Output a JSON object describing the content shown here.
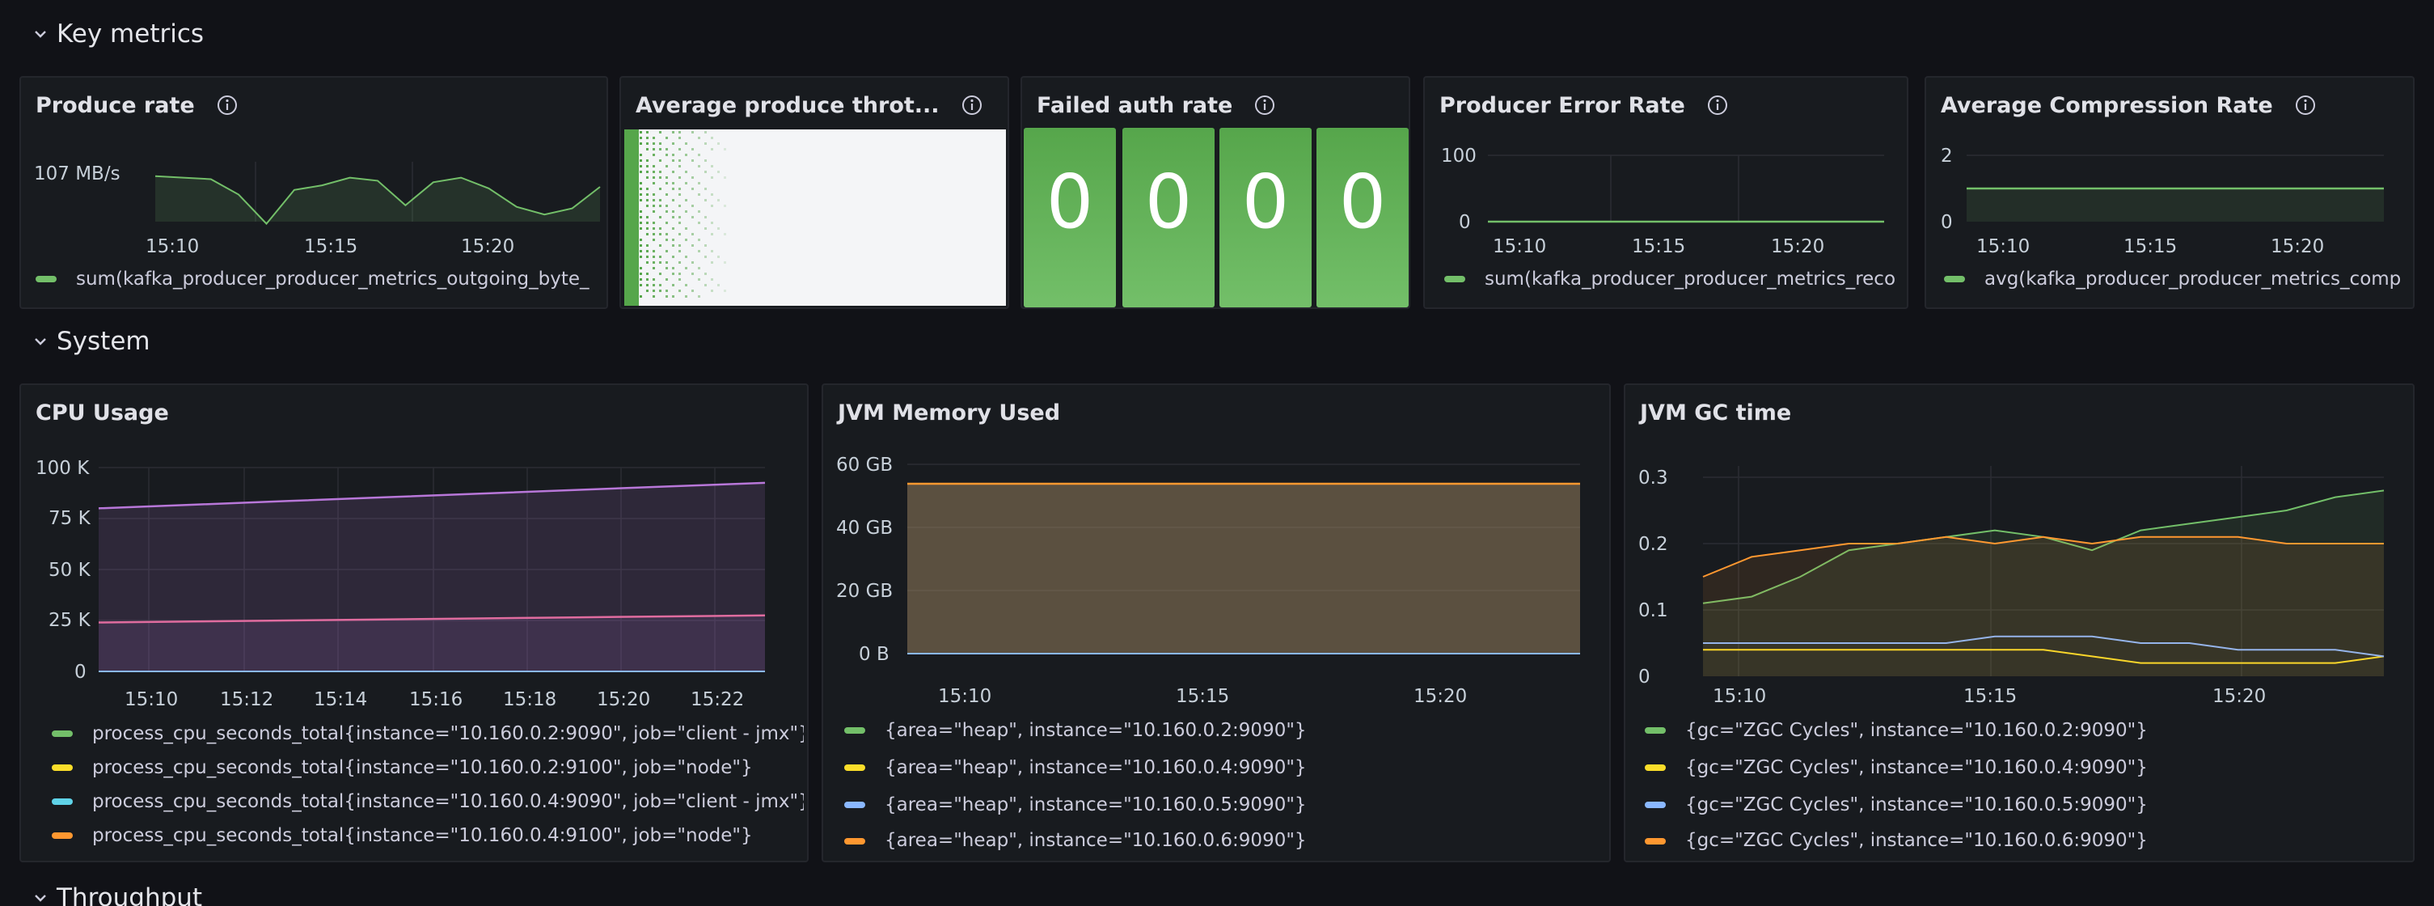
{
  "rows": {
    "key_metrics": "Key metrics",
    "system": "System",
    "throughput": "Throughput"
  },
  "panels": {
    "produce_rate": {
      "title": "Produce rate",
      "y_tick": "107 MB/s",
      "x_ticks": [
        "15:10",
        "15:15",
        "15:20"
      ],
      "legend": "sum(kafka_producer_producer_metrics_outgoing_byte_"
    },
    "avg_throttle": {
      "title": "Average produce throt..."
    },
    "failed_auth": {
      "title": "Failed auth rate",
      "values": [
        "0",
        "0",
        "0",
        "0"
      ]
    },
    "producer_error": {
      "title": "Producer Error Rate",
      "y_ticks": [
        "100",
        "0"
      ],
      "x_ticks": [
        "15:10",
        "15:15",
        "15:20"
      ],
      "legend": "sum(kafka_producer_producer_metrics_reco"
    },
    "avg_compression": {
      "title": "Average Compression Rate",
      "y_ticks": [
        "2",
        "0"
      ],
      "x_ticks": [
        "15:10",
        "15:15",
        "15:20"
      ],
      "legend": "avg(kafka_producer_producer_metrics_comp"
    },
    "cpu_usage": {
      "title": "CPU Usage",
      "y_ticks": [
        "100 K",
        "75 K",
        "50 K",
        "25 K",
        "0"
      ],
      "x_ticks": [
        "15:10",
        "15:12",
        "15:14",
        "15:16",
        "15:18",
        "15:20",
        "15:22"
      ],
      "legend": [
        "process_cpu_seconds_total{instance=\"10.160.0.2:9090\", job=\"client - jmx\"}",
        "process_cpu_seconds_total{instance=\"10.160.0.2:9100\", job=\"node\"}",
        "process_cpu_seconds_total{instance=\"10.160.0.4:9090\", job=\"client - jmx\"}",
        "process_cpu_seconds_total{instance=\"10.160.0.4:9100\", job=\"node\"}"
      ]
    },
    "jvm_memory": {
      "title": "JVM Memory Used",
      "y_ticks": [
        "60 GB",
        "40 GB",
        "20 GB",
        "0 B"
      ],
      "x_ticks": [
        "15:10",
        "15:15",
        "15:20"
      ],
      "legend": [
        "{area=\"heap\", instance=\"10.160.0.2:9090\"}",
        "{area=\"heap\", instance=\"10.160.0.4:9090\"}",
        "{area=\"heap\", instance=\"10.160.0.5:9090\"}",
        "{area=\"heap\", instance=\"10.160.0.6:9090\"}"
      ]
    },
    "jvm_gc": {
      "title": "JVM GC time",
      "y_ticks": [
        "0.3",
        "0.2",
        "0.1",
        "0"
      ],
      "x_ticks": [
        "15:10",
        "15:15",
        "15:20"
      ],
      "legend": [
        "{gc=\"ZGC Cycles\", instance=\"10.160.0.2:9090\"}",
        "{gc=\"ZGC Cycles\", instance=\"10.160.0.4:9090\"}",
        "{gc=\"ZGC Cycles\", instance=\"10.160.0.5:9090\"}",
        "{gc=\"ZGC Cycles\", instance=\"10.160.0.6:9090\"}"
      ]
    }
  },
  "colors": {
    "green": "#73bf69",
    "yellow": "#fade2a",
    "blue": "#8ab8ff",
    "orange": "#ff9830",
    "cyan": "#5fd3e8",
    "purple": "#b877d9"
  },
  "icons": {
    "row_toggle": "chevron-down-icon",
    "panel_info": "info-icon"
  },
  "chart_data": [
    {
      "type": "area",
      "title": "Produce rate",
      "x": [
        "15:07",
        "15:08",
        "15:09",
        "15:10",
        "15:11",
        "15:12",
        "15:13",
        "15:14",
        "15:15",
        "15:16",
        "15:17",
        "15:18",
        "15:19",
        "15:20",
        "15:21",
        "15:22",
        "15:23"
      ],
      "series": [
        {
          "name": "sum(kafka_producer_producer_metrics_outgoing_byte_",
          "values": [
            107,
            106,
            105,
            95,
            76,
            98,
            101,
            106,
            104,
            88,
            103,
            106,
            99,
            87,
            82,
            86,
            100
          ]
        }
      ],
      "unit": "MB/s"
    },
    {
      "type": "stat",
      "title": "Failed auth rate",
      "values": [
        0,
        0,
        0,
        0
      ]
    },
    {
      "type": "line",
      "title": "Producer Error Rate",
      "x": [
        "15:07",
        "15:23"
      ],
      "series": [
        {
          "name": "sum(kafka_producer_producer_metrics_reco",
          "values": [
            0,
            0
          ]
        }
      ],
      "ylim": [
        0,
        100
      ]
    },
    {
      "type": "area",
      "title": "Average Compression Rate",
      "x": [
        "15:07",
        "15:23"
      ],
      "series": [
        {
          "name": "avg(kafka_producer_producer_metrics_comp",
          "values": [
            1,
            1
          ]
        }
      ],
      "ylim": [
        0,
        2
      ]
    },
    {
      "type": "area",
      "title": "CPU Usage",
      "x": [
        "15:09",
        "15:11",
        "15:13",
        "15:15",
        "15:17",
        "15:19",
        "15:21",
        "15:23"
      ],
      "series": [
        {
          "name": "process_cpu_seconds_total{instance=\"10.160.0.2:9090\", job=\"client - jmx\"}",
          "values": [
            24000,
            24500,
            25000,
            25500,
            26000,
            26500,
            27000,
            27500
          ]
        },
        {
          "name": "process_cpu_seconds_total{instance=\"10.160.0.2:9100\", job=\"node\"}",
          "values": [
            80000,
            81800,
            83600,
            85400,
            87200,
            89000,
            90800,
            92500
          ]
        }
      ],
      "ylim": [
        0,
        100000
      ]
    },
    {
      "type": "area",
      "title": "JVM Memory Used",
      "x": [
        "15:09",
        "15:23"
      ],
      "series": [
        {
          "name": "{area=\"heap\", instance=\"10.160.0.2:9090\"}",
          "values": [
            54,
            54
          ]
        }
      ],
      "ylim": [
        0,
        60
      ],
      "unit": "GB"
    },
    {
      "type": "line",
      "title": "JVM GC time",
      "x": [
        "15:09",
        "15:10",
        "15:11",
        "15:12",
        "15:13",
        "15:14",
        "15:15",
        "15:16",
        "15:17",
        "15:18",
        "15:19",
        "15:20",
        "15:21",
        "15:22",
        "15:23"
      ],
      "series": [
        {
          "name": "{gc=\"ZGC Cycles\", instance=\"10.160.0.2:9090\"}",
          "values": [
            0.11,
            0.12,
            0.15,
            0.19,
            0.2,
            0.21,
            0.22,
            0.21,
            0.19,
            0.22,
            0.23,
            0.24,
            0.25,
            0.27,
            0.28
          ]
        },
        {
          "name": "{gc=\"ZGC Cycles\", instance=\"10.160.0.4:9090\"}",
          "values": [
            0.04,
            0.04,
            0.04,
            0.04,
            0.04,
            0.04,
            0.04,
            0.04,
            0.03,
            0.02,
            0.02,
            0.02,
            0.02,
            0.02,
            0.03
          ]
        },
        {
          "name": "{gc=\"ZGC Cycles\", instance=\"10.160.0.5:9090\"}",
          "values": [
            0.05,
            0.05,
            0.05,
            0.05,
            0.05,
            0.05,
            0.06,
            0.06,
            0.06,
            0.05,
            0.05,
            0.04,
            0.04,
            0.04,
            0.03
          ]
        },
        {
          "name": "{gc=\"ZGC Cycles\", instance=\"10.160.0.6:9090\"}",
          "values": [
            0.15,
            0.18,
            0.19,
            0.2,
            0.2,
            0.21,
            0.2,
            0.21,
            0.2,
            0.21,
            0.21,
            0.21,
            0.2,
            0.2,
            0.2
          ]
        }
      ],
      "ylim": [
        0,
        0.3
      ]
    }
  ]
}
